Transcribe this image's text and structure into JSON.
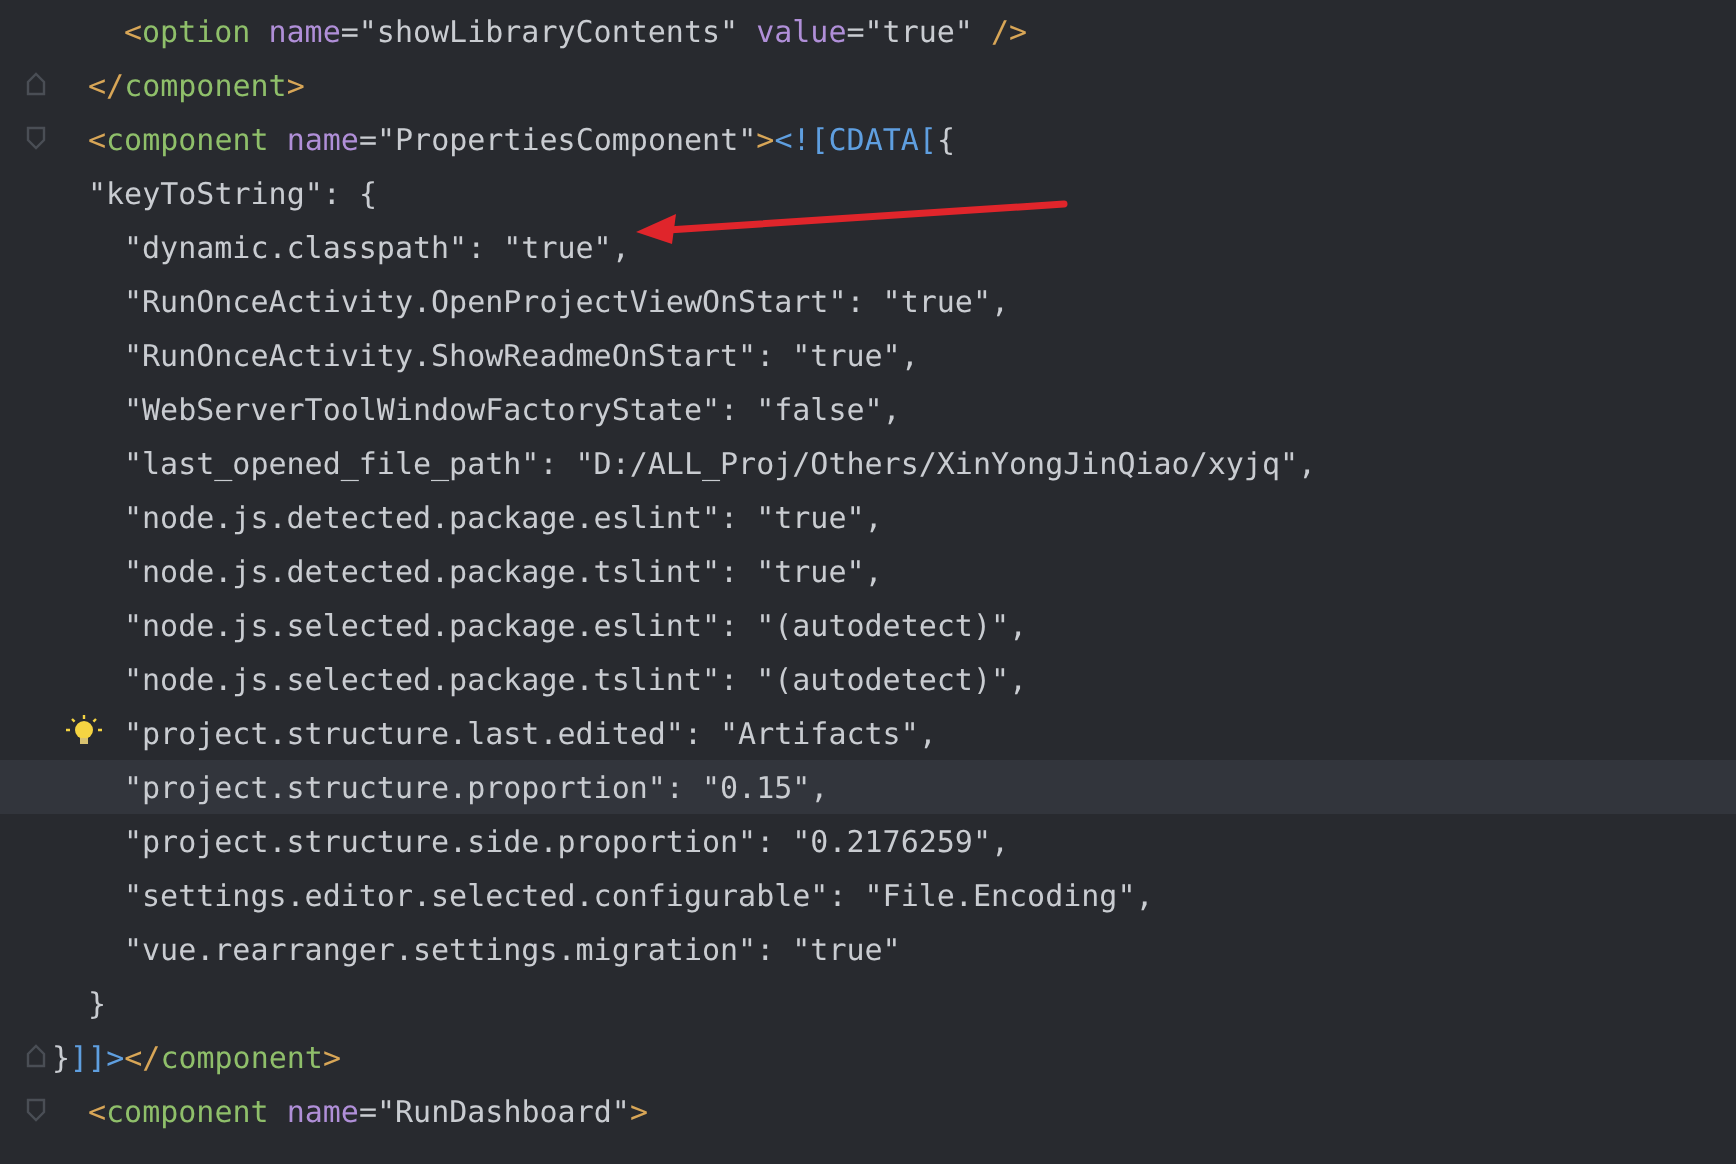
{
  "editor": {
    "lines": [
      {
        "children": [
          {
            "kind": "plain",
            "current": false,
            "tokens": [
              {
                "kind": "bracket",
                "text": "<"
              },
              {
                "kind": "tag",
                "text": "option "
              },
              {
                "kind": "attr",
                "text": "name"
              },
              {
                "kind": "punct",
                "text": "="
              },
              {
                "kind": "string",
                "text": "\"showLibraryContents\" "
              },
              {
                "kind": "attr",
                "text": "value"
              },
              {
                "kind": "punct",
                "text": "="
              },
              {
                "kind": "string",
                "text": "\"true\" "
              },
              {
                "kind": "bracket",
                "text": "/>"
              }
            ]
          }
        ]
      },
      {
        "kind": "fold-end",
        "current": false,
        "tokens": [
          {
            "kind": "bracket",
            "text": "</"
          },
          {
            "kind": "tag",
            "text": "component"
          },
          {
            "kind": "bracket",
            "text": ">"
          }
        ]
      },
      {
        "kind": "fold-start",
        "current": false,
        "tokens": [
          {
            "kind": "bracket",
            "text": "<"
          },
          {
            "kind": "tag",
            "text": "component "
          },
          {
            "kind": "attr",
            "text": "name"
          },
          {
            "kind": "punct",
            "text": "="
          },
          {
            "kind": "string",
            "text": "\"PropertiesComponent\""
          },
          {
            "kind": "bracket",
            "text": ">"
          },
          {
            "kind": "cdata",
            "text": "<![CDATA["
          },
          {
            "kind": "punct",
            "text": "{"
          }
        ]
      },
      {
        "kind": "plain",
        "current": false,
        "tokens": [
          {
            "kind": "punct",
            "text": "\"keyToString\": {"
          }
        ],
        "children": [
          {
            "kind": "plain",
            "current": false,
            "tokens": [
              {
                "kind": "punct",
                "text": "\"dynamic.classpath\": \"true\","
              }
            ]
          },
          {
            "kind": "plain",
            "current": false,
            "tokens": [
              {
                "kind": "punct",
                "text": "\"RunOnceActivity.OpenProjectViewOnStart\": \"true\","
              }
            ]
          },
          {
            "kind": "plain",
            "current": false,
            "tokens": [
              {
                "kind": "punct",
                "text": "\"RunOnceActivity.ShowReadmeOnStart\": \"true\","
              }
            ]
          },
          {
            "kind": "plain",
            "current": false,
            "tokens": [
              {
                "kind": "punct",
                "text": "\"WebServerToolWindowFactoryState\": \"false\","
              }
            ]
          },
          {
            "kind": "plain",
            "current": false,
            "tokens": [
              {
                "kind": "punct",
                "text": "\"last_opened_file_path\": \"D:/ALL_Proj/Others/XinYongJinQiao/xyjq\","
              }
            ]
          },
          {
            "kind": "plain",
            "current": false,
            "tokens": [
              {
                "kind": "punct",
                "text": "\"node.js.detected.package.eslint\": \"true\","
              }
            ]
          },
          {
            "kind": "plain",
            "current": false,
            "tokens": [
              {
                "kind": "punct",
                "text": "\"node.js.detected.package.tslint\": \"true\","
              }
            ]
          },
          {
            "kind": "plain",
            "current": false,
            "tokens": [
              {
                "kind": "punct",
                "text": "\"node.js.selected.package.eslint\": \"(autodetect)\","
              }
            ]
          },
          {
            "kind": "plain",
            "current": false,
            "tokens": [
              {
                "kind": "punct",
                "text": "\"node.js.selected.package.tslint\": \"(autodetect)\","
              }
            ]
          },
          {
            "kind": "bulb",
            "current": false,
            "tokens": [
              {
                "kind": "punct",
                "text": "\"project.structure.last.edited\": \"Artifacts\","
              }
            ]
          },
          {
            "kind": "plain",
            "current": true,
            "tokens": [
              {
                "kind": "punct",
                "text": "\"project.structure.proportion\": \"0.15\","
              }
            ]
          },
          {
            "kind": "plain",
            "current": false,
            "tokens": [
              {
                "kind": "punct",
                "text": "\"project.structure.side.proportion\": \"0.2176259\","
              }
            ]
          },
          {
            "kind": "plain",
            "current": false,
            "tokens": [
              {
                "kind": "punct",
                "text": "\"settings.editor.selected.configurable\": \"File.Encoding\","
              }
            ]
          },
          {
            "kind": "plain",
            "current": false,
            "tokens": [
              {
                "kind": "punct",
                "text": "\"vue.rearranger.settings.migration\": \"true\""
              }
            ]
          }
        ]
      },
      {
        "kind": "plain",
        "current": false,
        "tokens": [
          {
            "kind": "punct",
            "text": "}"
          }
        ]
      }
    ],
    "after": [
      {
        "kind": "fold-end",
        "current": false,
        "tokens": [
          {
            "kind": "punct",
            "text": "}"
          },
          {
            "kind": "cdata",
            "text": "]]>"
          },
          {
            "kind": "bracket",
            "text": "</"
          },
          {
            "kind": "tag",
            "text": "component"
          },
          {
            "kind": "bracket",
            "text": ">"
          }
        ]
      },
      {
        "children": [
          {
            "kind": "fold-start",
            "current": false,
            "tokens": [
              {
                "kind": "bracket",
                "text": "<"
              },
              {
                "kind": "tag",
                "text": "component "
              },
              {
                "kind": "attr",
                "text": "name"
              },
              {
                "kind": "punct",
                "text": "="
              },
              {
                "kind": "string",
                "text": "\"RunDashboard\""
              },
              {
                "kind": "bracket",
                "text": ">"
              }
            ]
          }
        ]
      }
    ]
  }
}
